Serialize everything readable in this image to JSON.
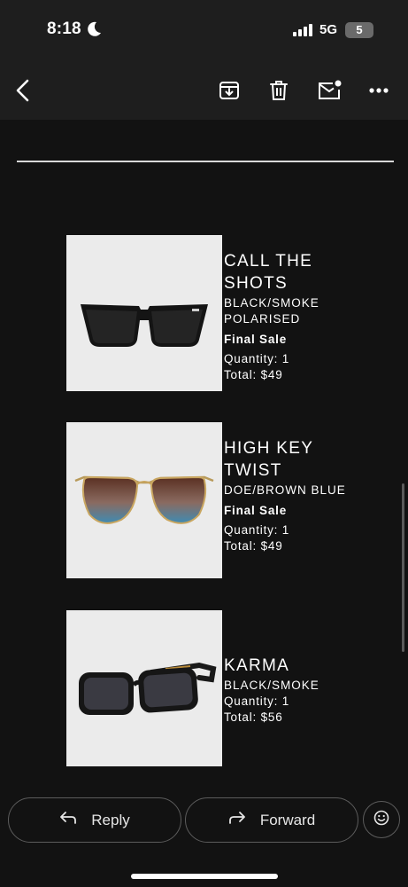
{
  "status": {
    "time": "8:18",
    "network": "5G",
    "battery": "5"
  },
  "toolbar": {
    "icons": [
      "back-arrow-icon",
      "archive-icon",
      "trash-icon",
      "mark-unread-icon",
      "more-icon"
    ]
  },
  "products": [
    {
      "name": "CALL THE SHOTS",
      "variant": "BLACK/SMOKE POLARISED",
      "sale": "Final Sale",
      "quantity": "Quantity:  1",
      "total": "Total:  $49",
      "image": "black-cat-eye-sunglasses"
    },
    {
      "name": "HIGH KEY TWIST",
      "variant": "DOE/BROWN BLUE",
      "sale": "Final Sale",
      "quantity": "Quantity:  1",
      "total": "Total:  $49",
      "image": "gold-aviator-gradient-sunglasses"
    },
    {
      "name": "KARMA",
      "variant": "BLACK/SMOKE",
      "quantity": "Quantity:  1",
      "total": "Total:  $56",
      "image": "black-rectangle-sunglasses"
    }
  ],
  "actions": {
    "reply": "Reply",
    "forward": "Forward"
  },
  "colors": {
    "background": "#121212",
    "bar": "#1e1e1e",
    "image_bg": "#ebebeb"
  }
}
